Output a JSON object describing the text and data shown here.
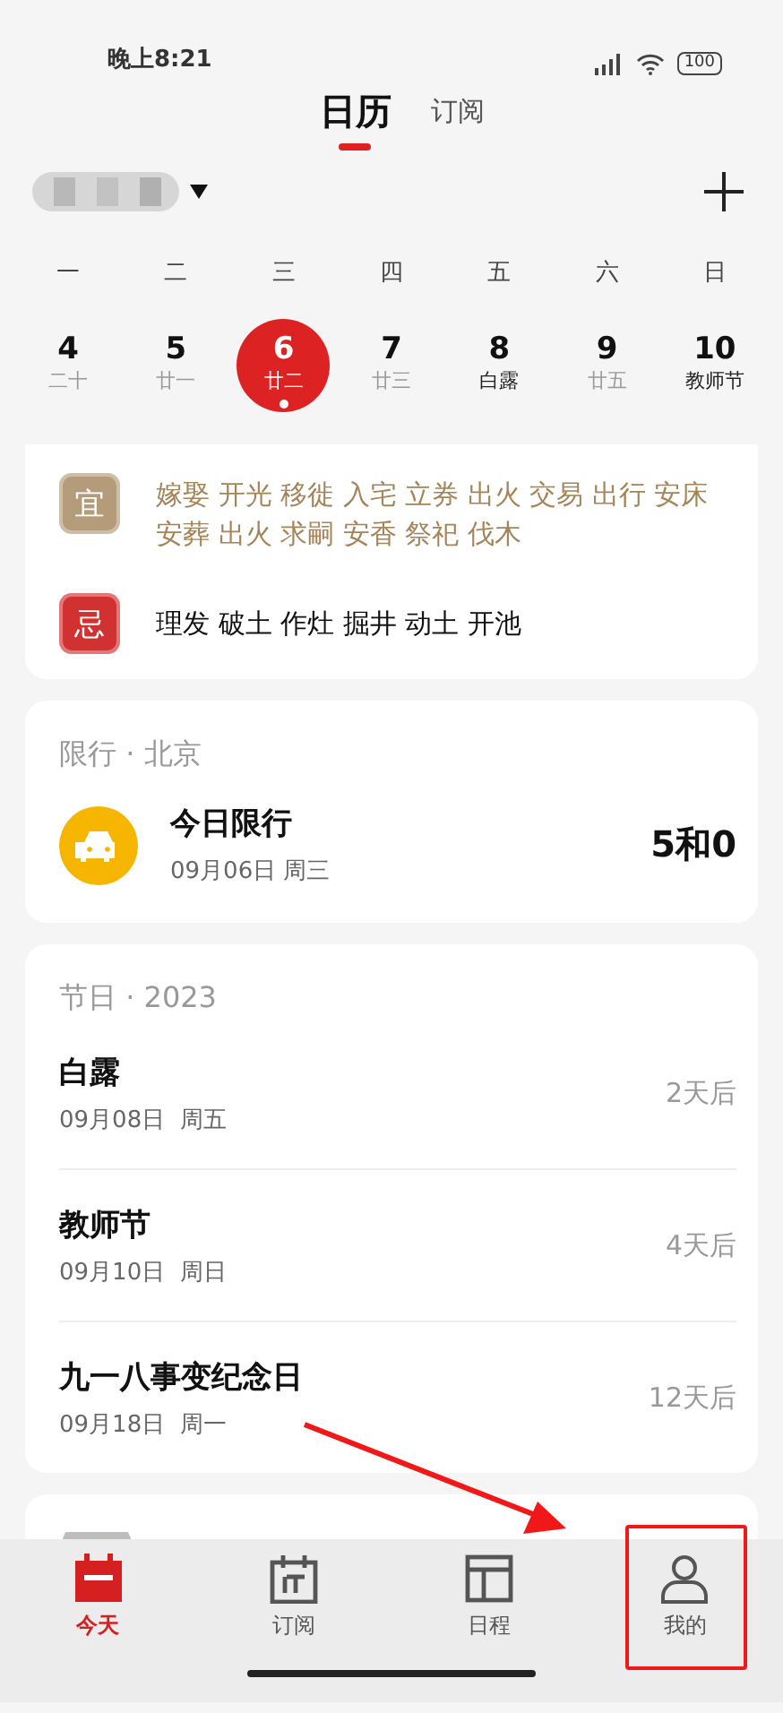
{
  "status_bar": {
    "time": "晚上8:21",
    "battery": "100"
  },
  "tabs": [
    {
      "label": "日历",
      "selected": true
    },
    {
      "label": "订阅",
      "selected": false
    }
  ],
  "weekdays": [
    "一",
    "二",
    "三",
    "四",
    "五",
    "六",
    "日"
  ],
  "days": [
    {
      "day": "4",
      "sub": "二十",
      "kind": "lunar",
      "selected": false,
      "dot": false
    },
    {
      "day": "5",
      "sub": "廿一",
      "kind": "lunar",
      "selected": false,
      "dot": false
    },
    {
      "day": "6",
      "sub": "廿二",
      "kind": "lunar",
      "selected": true,
      "dot": true
    },
    {
      "day": "7",
      "sub": "廿三",
      "kind": "lunar",
      "selected": false,
      "dot": false
    },
    {
      "day": "8",
      "sub": "白露",
      "kind": "festival",
      "selected": false,
      "dot": false
    },
    {
      "day": "9",
      "sub": "廿五",
      "kind": "lunar",
      "selected": false,
      "dot": false
    },
    {
      "day": "10",
      "sub": "教师节",
      "kind": "festival",
      "selected": false,
      "dot": false
    }
  ],
  "almanac": [
    {
      "kind": "good",
      "badge": "宜",
      "items": "嫁娶 开光 移徙 入宅 立券 出火 交易 出行 安床安葬 出火 求嗣 安香 祭祀 伐木"
    },
    {
      "kind": "bad",
      "badge": "忌",
      "items": "理发 破土 作灶 掘井 动土 开池"
    }
  ],
  "traffic": {
    "title": "限行 · 北京",
    "label": "今日限行",
    "date": "09月06日 周三",
    "numbers": "5和0"
  },
  "holidays": {
    "title": "节日 · 2023",
    "items": [
      {
        "name": "白露",
        "date": "09月08日  周五",
        "countdown": "2天后"
      },
      {
        "name": "教师节",
        "date": "09月10日  周日",
        "countdown": "4天后"
      },
      {
        "name": "九一八事变纪念日",
        "date": "09月18日  周一",
        "countdown": "12天后"
      }
    ]
  },
  "nav": [
    {
      "kind": "today",
      "label": "今天",
      "selected": true
    },
    {
      "kind": "subscribe",
      "label": "订阅",
      "selected": false
    },
    {
      "kind": "schedule",
      "label": "日程",
      "selected": false
    },
    {
      "kind": "profile",
      "label": "我的",
      "selected": false
    }
  ],
  "annotations": {
    "arrow": true,
    "highlight_box": true
  }
}
